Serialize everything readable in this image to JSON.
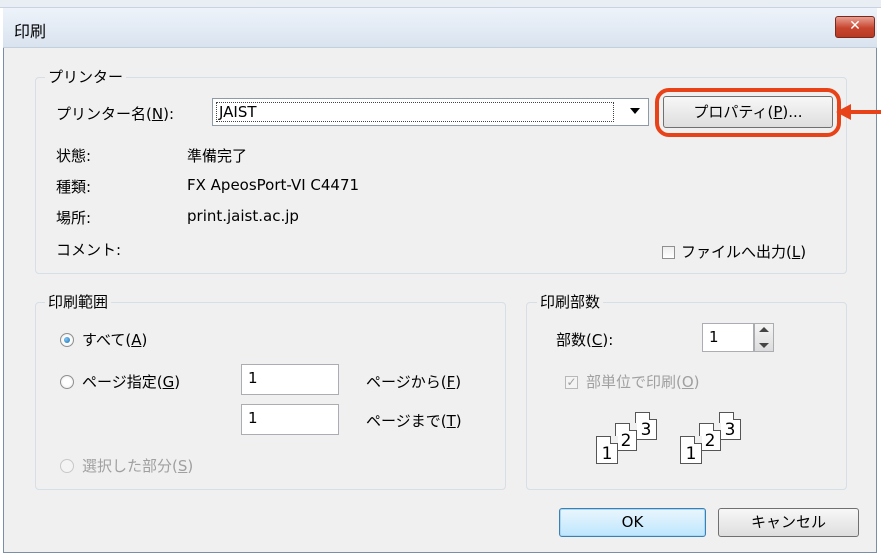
{
  "window": {
    "title": "印刷",
    "close_glyph": "✕"
  },
  "printer_group": {
    "label": "プリンター",
    "name_label_pre": "プリンター名(",
    "name_label_key": "N",
    "name_label_post": "):",
    "name_value": "JAIST",
    "properties_pre": "プロパティ(",
    "properties_key": "P",
    "properties_post": ")...",
    "status_label": "状態:",
    "status_value": "準備完了",
    "type_label": "種類:",
    "type_value": "FX ApeosPort-VI C4471",
    "location_label": "場所:",
    "location_value": "print.jaist.ac.jp",
    "comment_label": "コメント:",
    "print_to_file_pre": "ファイルへ出力(",
    "print_to_file_key": "L",
    "print_to_file_post": ")",
    "print_to_file_checked": false
  },
  "range_group": {
    "label": "印刷範囲",
    "all_pre": "すべて(",
    "all_key": "A",
    "all_post": ")",
    "pages_pre": "ページ指定(",
    "pages_key": "G",
    "pages_post": ")",
    "from_value": "1",
    "from_pre": "ページから(",
    "from_key": "F",
    "from_post": ")",
    "to_value": "1",
    "to_pre": "ページまで(",
    "to_key": "T",
    "to_post": ")",
    "selection_pre": "選択した部分(",
    "selection_key": "S",
    "selection_post": ")",
    "selected": "all"
  },
  "copies_group": {
    "label": "印刷部数",
    "copies_pre": "部数(",
    "copies_key": "C",
    "copies_post": "):",
    "copies_value": "1",
    "collate_pre": "部単位で印刷(",
    "collate_key": "O",
    "collate_post": ")",
    "collate_checked": true,
    "collate_check_glyph": "✓",
    "pages_set1": [
      "1",
      "2",
      "3"
    ],
    "pages_set2": [
      "1",
      "2",
      "3"
    ]
  },
  "buttons": {
    "ok": "OK",
    "cancel": "キャンセル"
  },
  "annotation": {
    "highlight_color": "#e84219"
  },
  "icons": [
    "close-icon",
    "dropdown-arrow-icon",
    "spin-up-icon",
    "spin-down-icon",
    "annotation-arrow-icon",
    "collate-pages-icon"
  ]
}
